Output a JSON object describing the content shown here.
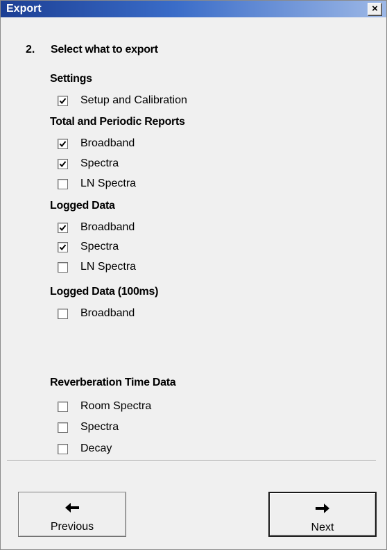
{
  "window": {
    "title": "Export",
    "close_glyph": "×"
  },
  "step": {
    "number": "2.",
    "title": "Select what to export"
  },
  "sections": [
    {
      "heading": "Settings",
      "items": [
        {
          "label": "Setup and Calibration",
          "checked": true
        }
      ]
    },
    {
      "heading": "Total and Periodic Reports",
      "items": [
        {
          "label": "Broadband",
          "checked": true
        },
        {
          "label": "Spectra",
          "checked": true
        },
        {
          "label": "LN Spectra",
          "checked": false
        }
      ]
    },
    {
      "heading": "Logged Data",
      "items": [
        {
          "label": "Broadband",
          "checked": true
        },
        {
          "label": "Spectra",
          "checked": true
        },
        {
          "label": "LN Spectra",
          "checked": false
        }
      ]
    },
    {
      "heading": "Logged Data (100ms)",
      "items": [
        {
          "label": "Broadband",
          "checked": false
        }
      ]
    },
    {
      "heading": "Reverberation Time Data",
      "items": [
        {
          "label": "Room Spectra",
          "checked": false
        },
        {
          "label": "Spectra",
          "checked": false
        },
        {
          "label": "Decay",
          "checked": false
        }
      ]
    }
  ],
  "buttons": {
    "previous": {
      "label": "Previous",
      "icon": "arrow-left-icon"
    },
    "next": {
      "label": "Next",
      "icon": "arrow-right-icon"
    }
  }
}
